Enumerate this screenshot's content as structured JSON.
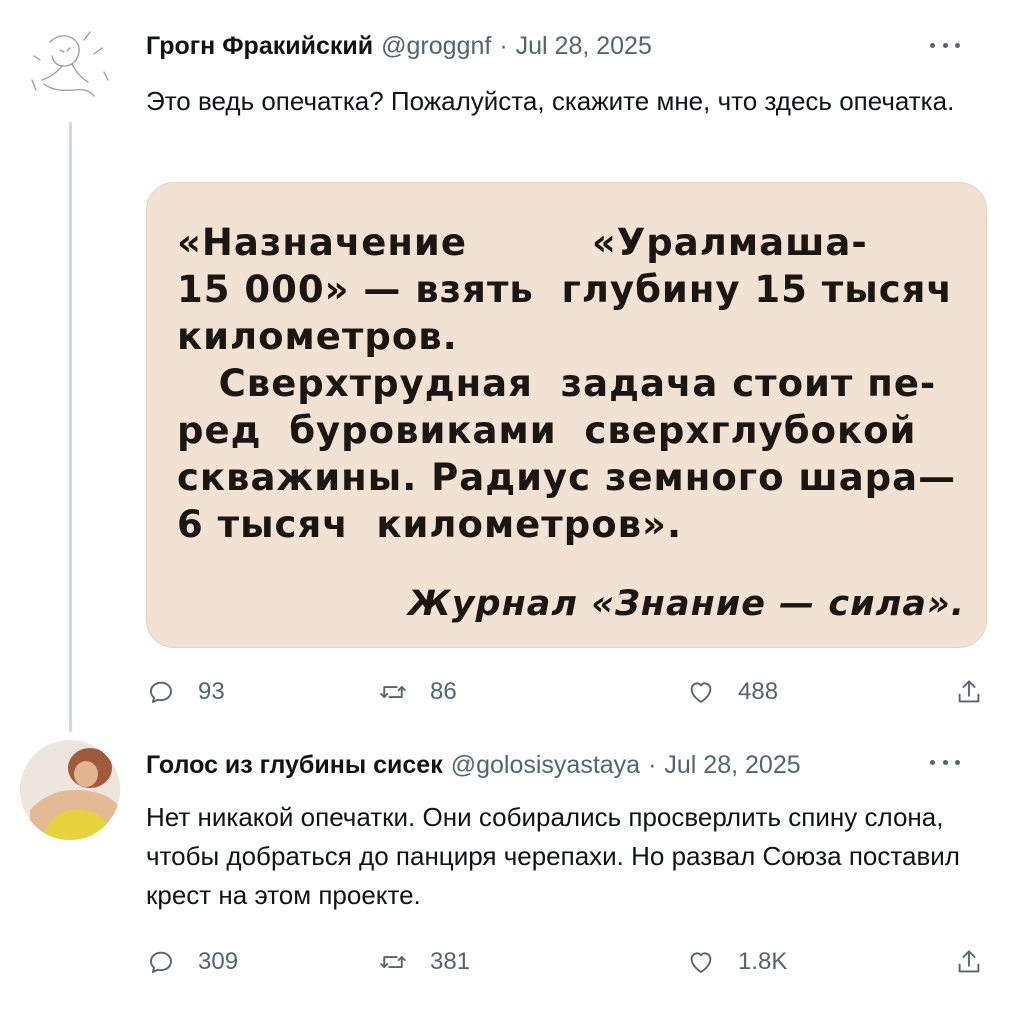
{
  "tweets": [
    {
      "author_name": "Грогн Фракийский",
      "handle": "@groggnf",
      "separator": "·",
      "date": "Jul 28, 2025",
      "text": "Это ведь опечатка? Пожалуйста, скажите мне, что здесь опечатка.",
      "media": {
        "lines": [
          "«Назначение         «Уралмаша-",
          "15 000» — взять  глубину 15 тысяч",
          "километров.",
          "   Сверхтрудная  задача стоит пе-",
          "ред  буровиками  сверхглубокой",
          "скважины. Радиус земного шара—",
          "6 тысяч  километров»."
        ],
        "signature": "Журнал «Знание — сила»."
      },
      "reply_count": "93",
      "retweet_count": "86",
      "like_count": "488"
    },
    {
      "author_name": "Голос из глубины сисек",
      "handle": "@golosisyastaya",
      "separator": "·",
      "date": "Jul 28, 2025",
      "text": "Нет никакой опечатки. Они собирались просверлить спину слона, чтобы добраться до панциря черепахи. Но развал Союза поставил крест на этом проекте.",
      "reply_count": "309",
      "retweet_count": "381",
      "like_count": "1.8K"
    }
  ],
  "icons": {
    "reply": "reply-icon",
    "retweet": "retweet-icon",
    "like": "heart-icon",
    "share": "share-icon",
    "more": "more-icon"
  },
  "colors": {
    "text": "#0f1419",
    "secondary": "#536471",
    "thread_line": "#cfd9de",
    "clipping_paper": "#f1e2d3"
  }
}
